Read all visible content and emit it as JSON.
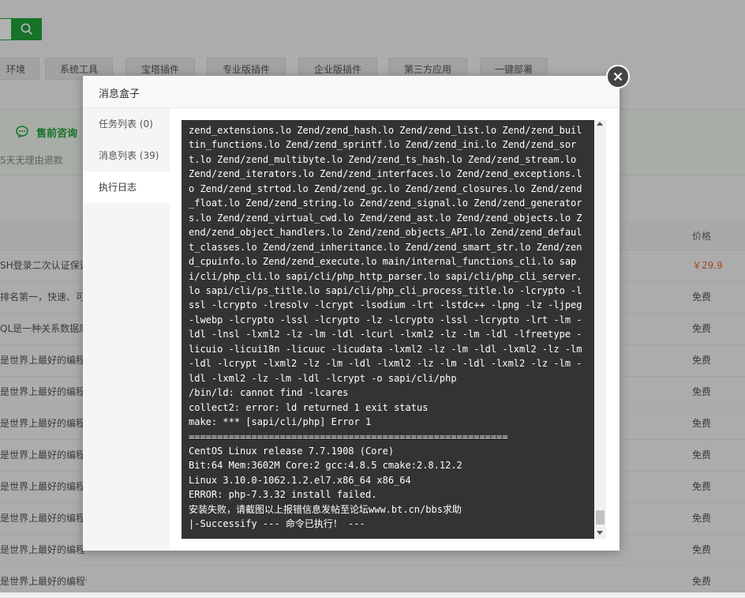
{
  "nav": {
    "tabs": [
      {
        "label": "环境"
      },
      {
        "label": "系统工具"
      },
      {
        "label": "宝塔插件"
      },
      {
        "label": "专业版插件"
      },
      {
        "label": "企业版插件"
      },
      {
        "label": "第三方应用"
      },
      {
        "label": "一键部署"
      }
    ]
  },
  "promo": {
    "title": "售前咨询",
    "subtitle": "5天无理由退款"
  },
  "table": {
    "price_header": "价格",
    "rows": [
      {
        "name": "SH登录二次认证保证",
        "price": "￥29.9",
        "paid": true
      },
      {
        "name": "排名第一，快速、可靠",
        "price": "免费",
        "paid": false
      },
      {
        "name": "QL是一种关系数据库",
        "price": "免费",
        "paid": false
      },
      {
        "name": "是世界上最好的编程语",
        "price": "免费",
        "paid": false
      },
      {
        "name": "是世界上最好的编程语",
        "price": "免费",
        "paid": false
      },
      {
        "name": "是世界上最好的编程语",
        "price": "免费",
        "paid": false
      },
      {
        "name": "是世界上最好的编程语",
        "price": "免费",
        "paid": false
      },
      {
        "name": "是世界上最好的编程语",
        "price": "免费",
        "paid": false
      },
      {
        "name": "是世界上最好的编程语",
        "price": "免费",
        "paid": false
      },
      {
        "name": "是世界上最好的编程语言",
        "price": "免费",
        "paid": false
      },
      {
        "name": "是世界上最好的编程语言",
        "price": "免费",
        "paid": false
      }
    ]
  },
  "dialog": {
    "title": "消息盒子",
    "sidebar": [
      {
        "label": "任务列表 (0)"
      },
      {
        "label": "消息列表 (39)"
      },
      {
        "label": "执行日志"
      }
    ],
    "log": "zend_extensions.lo Zend/zend_hash.lo Zend/zend_list.lo Zend/zend_builtin_functions.lo Zend/zend_sprintf.lo Zend/zend_ini.lo Zend/zend_sort.lo Zend/zend_multibyte.lo Zend/zend_ts_hash.lo Zend/zend_stream.lo Zend/zend_iterators.lo Zend/zend_interfaces.lo Zend/zend_exceptions.lo Zend/zend_strtod.lo Zend/zend_gc.lo Zend/zend_closures.lo Zend/zend_float.lo Zend/zend_string.lo Zend/zend_signal.lo Zend/zend_generators.lo Zend/zend_virtual_cwd.lo Zend/zend_ast.lo Zend/zend_objects.lo Zend/zend_object_handlers.lo Zend/zend_objects_API.lo Zend/zend_default_classes.lo Zend/zend_inheritance.lo Zend/zend_smart_str.lo Zend/zend_cpuinfo.lo Zend/zend_execute.lo main/internal_functions_cli.lo sapi/cli/php_cli.lo sapi/cli/php_http_parser.lo sapi/cli/php_cli_server.lo sapi/cli/ps_title.lo sapi/cli/php_cli_process_title.lo -lcrypto -lssl -lcrypto -lresolv -lcrypt -lsodium -lrt -lstdc++ -lpng -lz -ljpeg -lwebp -lcrypto -lssl -lcrypto -lz -lcrypto -lssl -lcrypto -lrt -lm -ldl -lnsl -lxml2 -lz -lm -ldl -lcurl -lxml2 -lz -lm -ldl -lfreetype -licuio -licui18n -licuuc -licudata -lxml2 -lz -lm -ldl -lxml2 -lz -lm -ldl -lcrypt -lxml2 -lz -lm -ldl -lxml2 -lz -lm -ldl -lxml2 -lz -lm -ldl -lxml2 -lz -lm -ldl -lcrypt -o sapi/cli/php\n/bin/ld: cannot find -lcares\ncollect2: error: ld returned 1 exit status\nmake: *** [sapi/cli/php] Error 1\n========================================================\nCentOS Linux release 7.7.1908 (Core)\nBit:64 Mem:3602M Core:2 gcc:4.8.5 cmake:2.8.12.2\nLinux 3.10.0-1062.1.2.el7.x86_64 x86_64\nERROR: php-7.3.32 install failed.\n安装失败，请截图以上报错信息发帖至论坛www.bt.cn/bbs求助\n|-Successify --- 命令已执行！ ---"
  },
  "colors": {
    "accent": "#20a53a",
    "paid_price": "#f0642c",
    "console_bg": "#333333"
  },
  "icons": {
    "search": "search-icon",
    "close": "close-icon",
    "consult": "chat-icon"
  }
}
